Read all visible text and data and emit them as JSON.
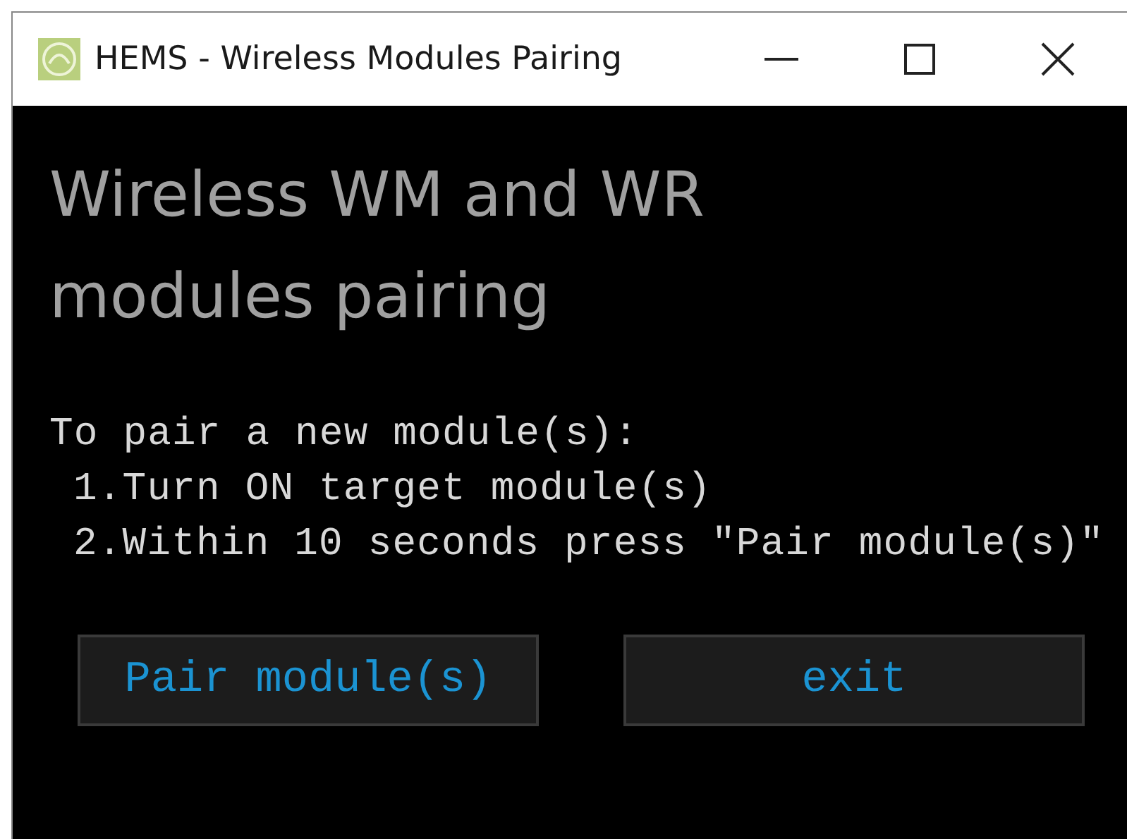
{
  "window": {
    "title": "HEMS - Wireless Modules Pairing"
  },
  "heading": "Wireless WM and WR modules pairing",
  "instructions": {
    "intro": "To pair a new module(s):",
    "steps": [
      "1.Turn ON target module(s)",
      "2.Within 10 seconds press \"Pair module(s)\""
    ]
  },
  "buttons": [
    {
      "label": "Pair module(s)"
    },
    {
      "label": "exit"
    }
  ]
}
